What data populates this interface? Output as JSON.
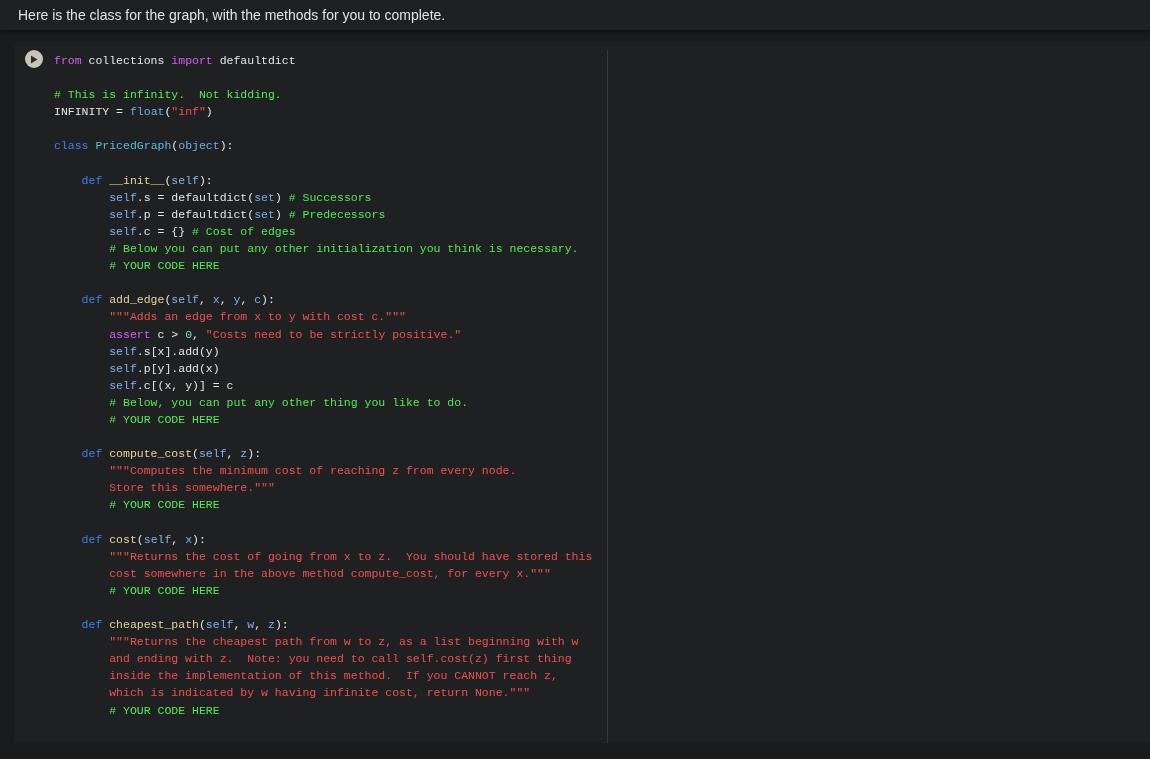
{
  "markdown_cell": {
    "text": "Here is the class for the graph, with the methods for you to complete."
  },
  "code_cell": {
    "blocks": [
      {
        "lines": [
          [
            {
              "kind": "keyword",
              "text": "from"
            },
            {
              "kind": "plain",
              "text": " collections "
            },
            {
              "kind": "keyword",
              "text": "import"
            },
            {
              "kind": "plain",
              "text": " defaultdict"
            }
          ]
        ]
      },
      {
        "lines": [
          [
            {
              "kind": "comment",
              "text": "# This is infinity.  Not kidding."
            }
          ],
          [
            {
              "kind": "plain",
              "text": "INFINITY = "
            },
            {
              "kind": "builtin",
              "text": "float"
            },
            {
              "kind": "plain",
              "text": "("
            },
            {
              "kind": "string",
              "text": "\"inf\""
            },
            {
              "kind": "plain",
              "text": ")"
            }
          ]
        ]
      },
      {
        "lines": [
          [
            {
              "kind": "storage",
              "text": "class"
            },
            {
              "kind": "classname",
              "text": " PricedGraph"
            },
            {
              "kind": "plain",
              "text": "("
            },
            {
              "kind": "builtin",
              "text": "object"
            },
            {
              "kind": "plain",
              "text": "):"
            }
          ]
        ]
      },
      {
        "lines": [
          [
            {
              "kind": "storage",
              "text": "    def"
            },
            {
              "kind": "func",
              "text": " __init__"
            },
            {
              "kind": "plain",
              "text": "("
            },
            {
              "kind": "self",
              "text": "self"
            },
            {
              "kind": "plain",
              "text": "):"
            }
          ],
          [
            {
              "kind": "self",
              "text": "        self"
            },
            {
              "kind": "plain",
              "text": ".s = defaultdict("
            },
            {
              "kind": "builtin",
              "text": "set"
            },
            {
              "kind": "plain",
              "text": ")"
            },
            {
              "kind": "comment",
              "text": " # Successors"
            }
          ],
          [
            {
              "kind": "self",
              "text": "        self"
            },
            {
              "kind": "plain",
              "text": ".p = defaultdict("
            },
            {
              "kind": "builtin",
              "text": "set"
            },
            {
              "kind": "plain",
              "text": ")"
            },
            {
              "kind": "comment",
              "text": " # Predecessors"
            }
          ],
          [
            {
              "kind": "self",
              "text": "        self"
            },
            {
              "kind": "plain",
              "text": ".c = {}"
            },
            {
              "kind": "comment",
              "text": " # Cost of edges"
            }
          ],
          [
            {
              "kind": "comment",
              "text": "        # Below you can put any other initialization you think is necessary."
            }
          ],
          [
            {
              "kind": "comment",
              "text": "        # YOUR CODE HERE"
            }
          ]
        ]
      },
      {
        "lines": [
          [
            {
              "kind": "storage",
              "text": "    def"
            },
            {
              "kind": "func",
              "text": " add_edge"
            },
            {
              "kind": "plain",
              "text": "("
            },
            {
              "kind": "self",
              "text": "self"
            },
            {
              "kind": "plain",
              "text": ", "
            },
            {
              "kind": "param",
              "text": "x"
            },
            {
              "kind": "plain",
              "text": ", "
            },
            {
              "kind": "param",
              "text": "y"
            },
            {
              "kind": "plain",
              "text": ", "
            },
            {
              "kind": "param",
              "text": "c"
            },
            {
              "kind": "plain",
              "text": "):"
            }
          ],
          [
            {
              "kind": "string",
              "text": "        \"\"\"Adds an edge from x to y with cost c.\"\"\""
            }
          ],
          [
            {
              "kind": "keyword",
              "text": "        assert"
            },
            {
              "kind": "plain",
              "text": " c > "
            },
            {
              "kind": "number",
              "text": "0"
            },
            {
              "kind": "plain",
              "text": ", "
            },
            {
              "kind": "string",
              "text": "\"Costs need to be strictly positive.\""
            }
          ],
          [
            {
              "kind": "self",
              "text": "        self"
            },
            {
              "kind": "plain",
              "text": ".s[x].add(y)"
            }
          ],
          [
            {
              "kind": "self",
              "text": "        self"
            },
            {
              "kind": "plain",
              "text": ".p[y].add(x)"
            }
          ],
          [
            {
              "kind": "self",
              "text": "        self"
            },
            {
              "kind": "plain",
              "text": ".c[(x, y)] = c"
            }
          ],
          [
            {
              "kind": "comment",
              "text": "        # Below, you can put any other thing you like to do."
            }
          ],
          [
            {
              "kind": "comment",
              "text": "        # YOUR CODE HERE"
            }
          ]
        ]
      },
      {
        "lines": [
          [
            {
              "kind": "storage",
              "text": "    def"
            },
            {
              "kind": "func",
              "text": " compute_cost"
            },
            {
              "kind": "plain",
              "text": "("
            },
            {
              "kind": "self",
              "text": "self"
            },
            {
              "kind": "plain",
              "text": ", "
            },
            {
              "kind": "param",
              "text": "z"
            },
            {
              "kind": "plain",
              "text": "):"
            }
          ],
          [
            {
              "kind": "string",
              "text": "        \"\"\"Computes the minimum cost of reaching z from every node."
            }
          ],
          [
            {
              "kind": "string",
              "text": "        Store this somewhere.\"\"\""
            }
          ],
          [
            {
              "kind": "comment",
              "text": "        # YOUR CODE HERE"
            }
          ]
        ]
      },
      {
        "lines": [
          [
            {
              "kind": "storage",
              "text": "    def"
            },
            {
              "kind": "func",
              "text": " cost"
            },
            {
              "kind": "plain",
              "text": "("
            },
            {
              "kind": "self",
              "text": "self"
            },
            {
              "kind": "plain",
              "text": ", "
            },
            {
              "kind": "param",
              "text": "x"
            },
            {
              "kind": "plain",
              "text": "):"
            }
          ],
          [
            {
              "kind": "string",
              "text": "        \"\"\"Returns the cost of going from x to z.  You should have stored this"
            }
          ],
          [
            {
              "kind": "string",
              "text": "        cost somewhere in the above method compute_cost, for every x.\"\"\""
            }
          ],
          [
            {
              "kind": "comment",
              "text": "        # YOUR CODE HERE"
            }
          ]
        ]
      },
      {
        "lines": [
          [
            {
              "kind": "storage",
              "text": "    def"
            },
            {
              "kind": "func",
              "text": " cheapest_path"
            },
            {
              "kind": "plain",
              "text": "("
            },
            {
              "kind": "self",
              "text": "self"
            },
            {
              "kind": "plain",
              "text": ", "
            },
            {
              "kind": "param",
              "text": "w"
            },
            {
              "kind": "plain",
              "text": ", "
            },
            {
              "kind": "param",
              "text": "z"
            },
            {
              "kind": "plain",
              "text": "):"
            }
          ],
          [
            {
              "kind": "string",
              "text": "        \"\"\"Returns the cheapest path from w to z, as a list beginning with w"
            }
          ],
          [
            {
              "kind": "string",
              "text": "        and ending with z.  Note: you need to call self.cost(z) first thing"
            }
          ],
          [
            {
              "kind": "string",
              "text": "        inside the implementation of this method.  If you CANNOT reach z,"
            }
          ],
          [
            {
              "kind": "string",
              "text": "        which is indicated by w having infinite cost, return None.\"\"\""
            }
          ],
          [
            {
              "kind": "comment",
              "text": "        # YOUR CODE HERE"
            }
          ]
        ]
      }
    ]
  }
}
